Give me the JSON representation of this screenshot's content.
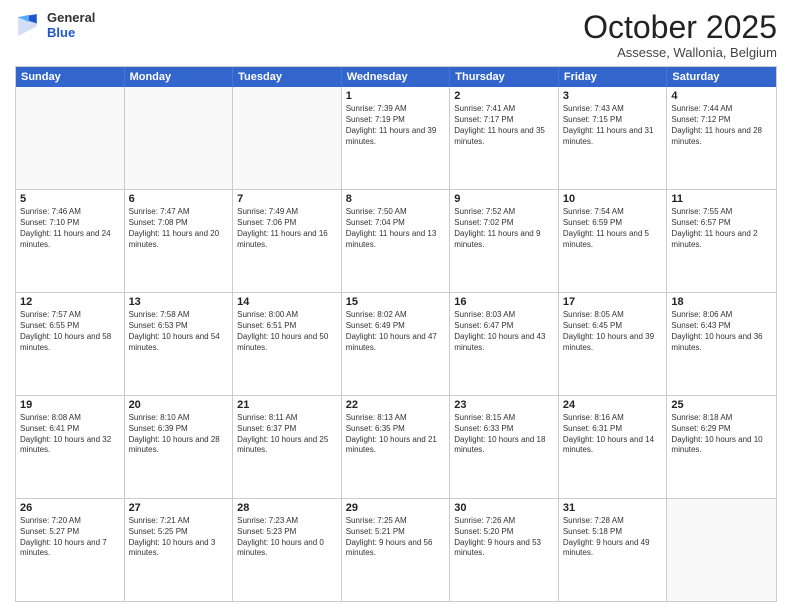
{
  "logo": {
    "general": "General",
    "blue": "Blue"
  },
  "header": {
    "month": "October 2025",
    "location": "Assesse, Wallonia, Belgium"
  },
  "days": [
    "Sunday",
    "Monday",
    "Tuesday",
    "Wednesday",
    "Thursday",
    "Friday",
    "Saturday"
  ],
  "weeks": [
    [
      {
        "day": "",
        "empty": true
      },
      {
        "day": "",
        "empty": true
      },
      {
        "day": "",
        "empty": true
      },
      {
        "day": "1",
        "sunrise": "Sunrise: 7:39 AM",
        "sunset": "Sunset: 7:19 PM",
        "daylight": "Daylight: 11 hours and 39 minutes."
      },
      {
        "day": "2",
        "sunrise": "Sunrise: 7:41 AM",
        "sunset": "Sunset: 7:17 PM",
        "daylight": "Daylight: 11 hours and 35 minutes."
      },
      {
        "day": "3",
        "sunrise": "Sunrise: 7:43 AM",
        "sunset": "Sunset: 7:15 PM",
        "daylight": "Daylight: 11 hours and 31 minutes."
      },
      {
        "day": "4",
        "sunrise": "Sunrise: 7:44 AM",
        "sunset": "Sunset: 7:12 PM",
        "daylight": "Daylight: 11 hours and 28 minutes."
      }
    ],
    [
      {
        "day": "5",
        "sunrise": "Sunrise: 7:46 AM",
        "sunset": "Sunset: 7:10 PM",
        "daylight": "Daylight: 11 hours and 24 minutes."
      },
      {
        "day": "6",
        "sunrise": "Sunrise: 7:47 AM",
        "sunset": "Sunset: 7:08 PM",
        "daylight": "Daylight: 11 hours and 20 minutes."
      },
      {
        "day": "7",
        "sunrise": "Sunrise: 7:49 AM",
        "sunset": "Sunset: 7:06 PM",
        "daylight": "Daylight: 11 hours and 16 minutes."
      },
      {
        "day": "8",
        "sunrise": "Sunrise: 7:50 AM",
        "sunset": "Sunset: 7:04 PM",
        "daylight": "Daylight: 11 hours and 13 minutes."
      },
      {
        "day": "9",
        "sunrise": "Sunrise: 7:52 AM",
        "sunset": "Sunset: 7:02 PM",
        "daylight": "Daylight: 11 hours and 9 minutes."
      },
      {
        "day": "10",
        "sunrise": "Sunrise: 7:54 AM",
        "sunset": "Sunset: 6:59 PM",
        "daylight": "Daylight: 11 hours and 5 minutes."
      },
      {
        "day": "11",
        "sunrise": "Sunrise: 7:55 AM",
        "sunset": "Sunset: 6:57 PM",
        "daylight": "Daylight: 11 hours and 2 minutes."
      }
    ],
    [
      {
        "day": "12",
        "sunrise": "Sunrise: 7:57 AM",
        "sunset": "Sunset: 6:55 PM",
        "daylight": "Daylight: 10 hours and 58 minutes."
      },
      {
        "day": "13",
        "sunrise": "Sunrise: 7:58 AM",
        "sunset": "Sunset: 6:53 PM",
        "daylight": "Daylight: 10 hours and 54 minutes."
      },
      {
        "day": "14",
        "sunrise": "Sunrise: 8:00 AM",
        "sunset": "Sunset: 6:51 PM",
        "daylight": "Daylight: 10 hours and 50 minutes."
      },
      {
        "day": "15",
        "sunrise": "Sunrise: 8:02 AM",
        "sunset": "Sunset: 6:49 PM",
        "daylight": "Daylight: 10 hours and 47 minutes."
      },
      {
        "day": "16",
        "sunrise": "Sunrise: 8:03 AM",
        "sunset": "Sunset: 6:47 PM",
        "daylight": "Daylight: 10 hours and 43 minutes."
      },
      {
        "day": "17",
        "sunrise": "Sunrise: 8:05 AM",
        "sunset": "Sunset: 6:45 PM",
        "daylight": "Daylight: 10 hours and 39 minutes."
      },
      {
        "day": "18",
        "sunrise": "Sunrise: 8:06 AM",
        "sunset": "Sunset: 6:43 PM",
        "daylight": "Daylight: 10 hours and 36 minutes."
      }
    ],
    [
      {
        "day": "19",
        "sunrise": "Sunrise: 8:08 AM",
        "sunset": "Sunset: 6:41 PM",
        "daylight": "Daylight: 10 hours and 32 minutes."
      },
      {
        "day": "20",
        "sunrise": "Sunrise: 8:10 AM",
        "sunset": "Sunset: 6:39 PM",
        "daylight": "Daylight: 10 hours and 28 minutes."
      },
      {
        "day": "21",
        "sunrise": "Sunrise: 8:11 AM",
        "sunset": "Sunset: 6:37 PM",
        "daylight": "Daylight: 10 hours and 25 minutes."
      },
      {
        "day": "22",
        "sunrise": "Sunrise: 8:13 AM",
        "sunset": "Sunset: 6:35 PM",
        "daylight": "Daylight: 10 hours and 21 minutes."
      },
      {
        "day": "23",
        "sunrise": "Sunrise: 8:15 AM",
        "sunset": "Sunset: 6:33 PM",
        "daylight": "Daylight: 10 hours and 18 minutes."
      },
      {
        "day": "24",
        "sunrise": "Sunrise: 8:16 AM",
        "sunset": "Sunset: 6:31 PM",
        "daylight": "Daylight: 10 hours and 14 minutes."
      },
      {
        "day": "25",
        "sunrise": "Sunrise: 8:18 AM",
        "sunset": "Sunset: 6:29 PM",
        "daylight": "Daylight: 10 hours and 10 minutes."
      }
    ],
    [
      {
        "day": "26",
        "sunrise": "Sunrise: 7:20 AM",
        "sunset": "Sunset: 5:27 PM",
        "daylight": "Daylight: 10 hours and 7 minutes."
      },
      {
        "day": "27",
        "sunrise": "Sunrise: 7:21 AM",
        "sunset": "Sunset: 5:25 PM",
        "daylight": "Daylight: 10 hours and 3 minutes."
      },
      {
        "day": "28",
        "sunrise": "Sunrise: 7:23 AM",
        "sunset": "Sunset: 5:23 PM",
        "daylight": "Daylight: 10 hours and 0 minutes."
      },
      {
        "day": "29",
        "sunrise": "Sunrise: 7:25 AM",
        "sunset": "Sunset: 5:21 PM",
        "daylight": "Daylight: 9 hours and 56 minutes."
      },
      {
        "day": "30",
        "sunrise": "Sunrise: 7:26 AM",
        "sunset": "Sunset: 5:20 PM",
        "daylight": "Daylight: 9 hours and 53 minutes."
      },
      {
        "day": "31",
        "sunrise": "Sunrise: 7:28 AM",
        "sunset": "Sunset: 5:18 PM",
        "daylight": "Daylight: 9 hours and 49 minutes."
      },
      {
        "day": "",
        "empty": true
      }
    ]
  ]
}
